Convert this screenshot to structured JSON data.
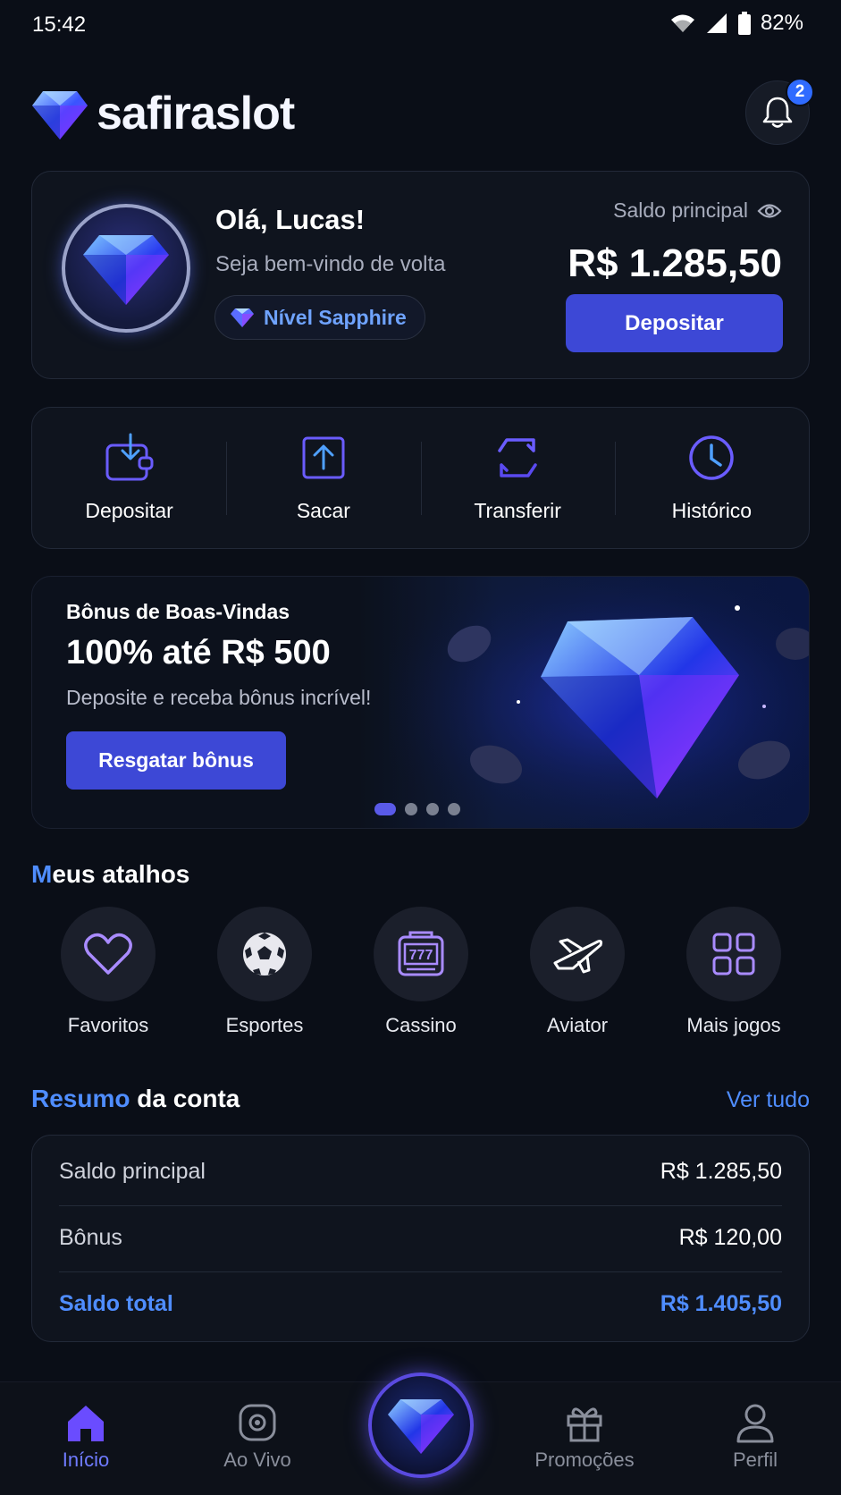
{
  "status_bar": {
    "time": "15:42",
    "battery": "82%"
  },
  "header": {
    "logo_text": "safiraslot",
    "notification_count": "2"
  },
  "profile": {
    "greeting": "Olá, Lucas!",
    "welcome": "Seja bem-vindo de volta",
    "level": "Nível Sapphire",
    "balance_label": "Saldo principal",
    "balance_value": "R$ 1.285,50",
    "deposit_label": "Depositar"
  },
  "actions": [
    {
      "label": "Depositar",
      "icon": "wallet-download-icon"
    },
    {
      "label": "Sacar",
      "icon": "upload-icon"
    },
    {
      "label": "Transferir",
      "icon": "transfer-icon"
    },
    {
      "label": "Histórico",
      "icon": "clock-icon"
    }
  ],
  "banner": {
    "kicker": "Bônus de Boas-Vindas",
    "title": "100% até R$ 500",
    "subtitle": "Deposite e receba bônus incrível!",
    "button": "Resgatar bônus",
    "active_slide": 1,
    "slide_count": 4
  },
  "shortcuts": {
    "title_accent": "M",
    "title_rest": "eus atalhos",
    "items": [
      {
        "label": "Favoritos",
        "icon": "heart-icon"
      },
      {
        "label": "Esportes",
        "icon": "soccer-ball-icon"
      },
      {
        "label": "Cassino",
        "icon": "slot-machine-icon"
      },
      {
        "label": "Aviator",
        "icon": "airplane-icon"
      },
      {
        "label": "Mais jogos",
        "icon": "grid-icon"
      }
    ]
  },
  "summary": {
    "title_accent": "Resumo",
    "title_rest": " da conta",
    "view_all": "Ver tudo",
    "rows": [
      {
        "label": "Saldo principal",
        "value": "R$ 1.285,50"
      },
      {
        "label": "Bônus",
        "value": "R$ 120,00"
      },
      {
        "label": "Saldo total",
        "value": "R$ 1.405,50"
      }
    ]
  },
  "bottom_nav": [
    {
      "label": "Início",
      "icon": "home-icon",
      "active": true
    },
    {
      "label": "Ao Vivo",
      "icon": "live-camera-icon",
      "active": false
    },
    {
      "label": "Promoções",
      "icon": "gift-icon",
      "active": false
    },
    {
      "label": "Perfil",
      "icon": "user-icon",
      "active": false
    }
  ],
  "colors": {
    "accent": "#4f8dff",
    "button": "#3d48d6",
    "background": "#0a0e17"
  }
}
